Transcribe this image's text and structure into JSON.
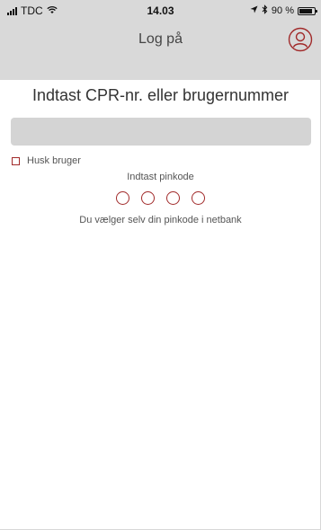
{
  "status_bar": {
    "carrier": "TDC",
    "time": "14.03",
    "battery": "90 %",
    "battery_level": 0.9
  },
  "navbar": {
    "title": "Log på",
    "profile_icon": "user-profile-icon"
  },
  "login": {
    "heading": "Indtast CPR-nr. eller brugernummer",
    "user_field_value": "",
    "remember_label": "Husk bruger",
    "remember_checked": false,
    "pin_label": "Indtast pinkode",
    "pin_length": 4,
    "hint": "Du vælger selv din pinkode i netbank"
  },
  "colors": {
    "accent": "#a12a2a",
    "header_bg": "#d9d9d9",
    "field_bg": "#d4d4d4"
  }
}
